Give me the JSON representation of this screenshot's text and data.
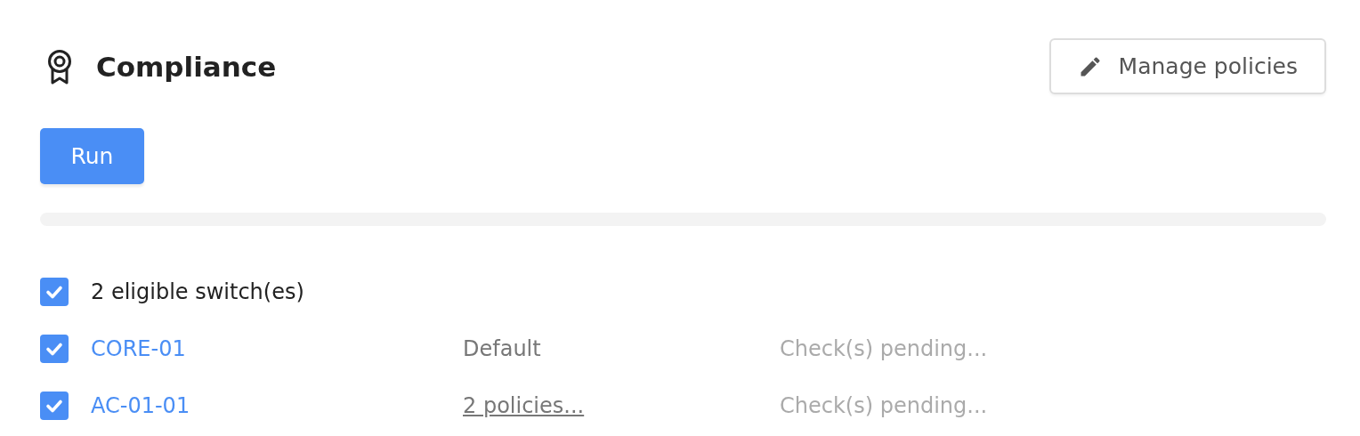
{
  "header": {
    "title": "Compliance",
    "manage_button": "Manage policies"
  },
  "run_button": "Run",
  "select_all": {
    "label": "2 eligible switch(es)",
    "checked": true
  },
  "switches": [
    {
      "name": "CORE-01",
      "checked": true,
      "policy": {
        "kind": "text",
        "label": "Default"
      },
      "status": "Check(s) pending..."
    },
    {
      "name": "AC-01-01",
      "checked": true,
      "policy": {
        "kind": "link",
        "label": "2 policies..."
      },
      "status": "Check(s) pending..."
    }
  ]
}
